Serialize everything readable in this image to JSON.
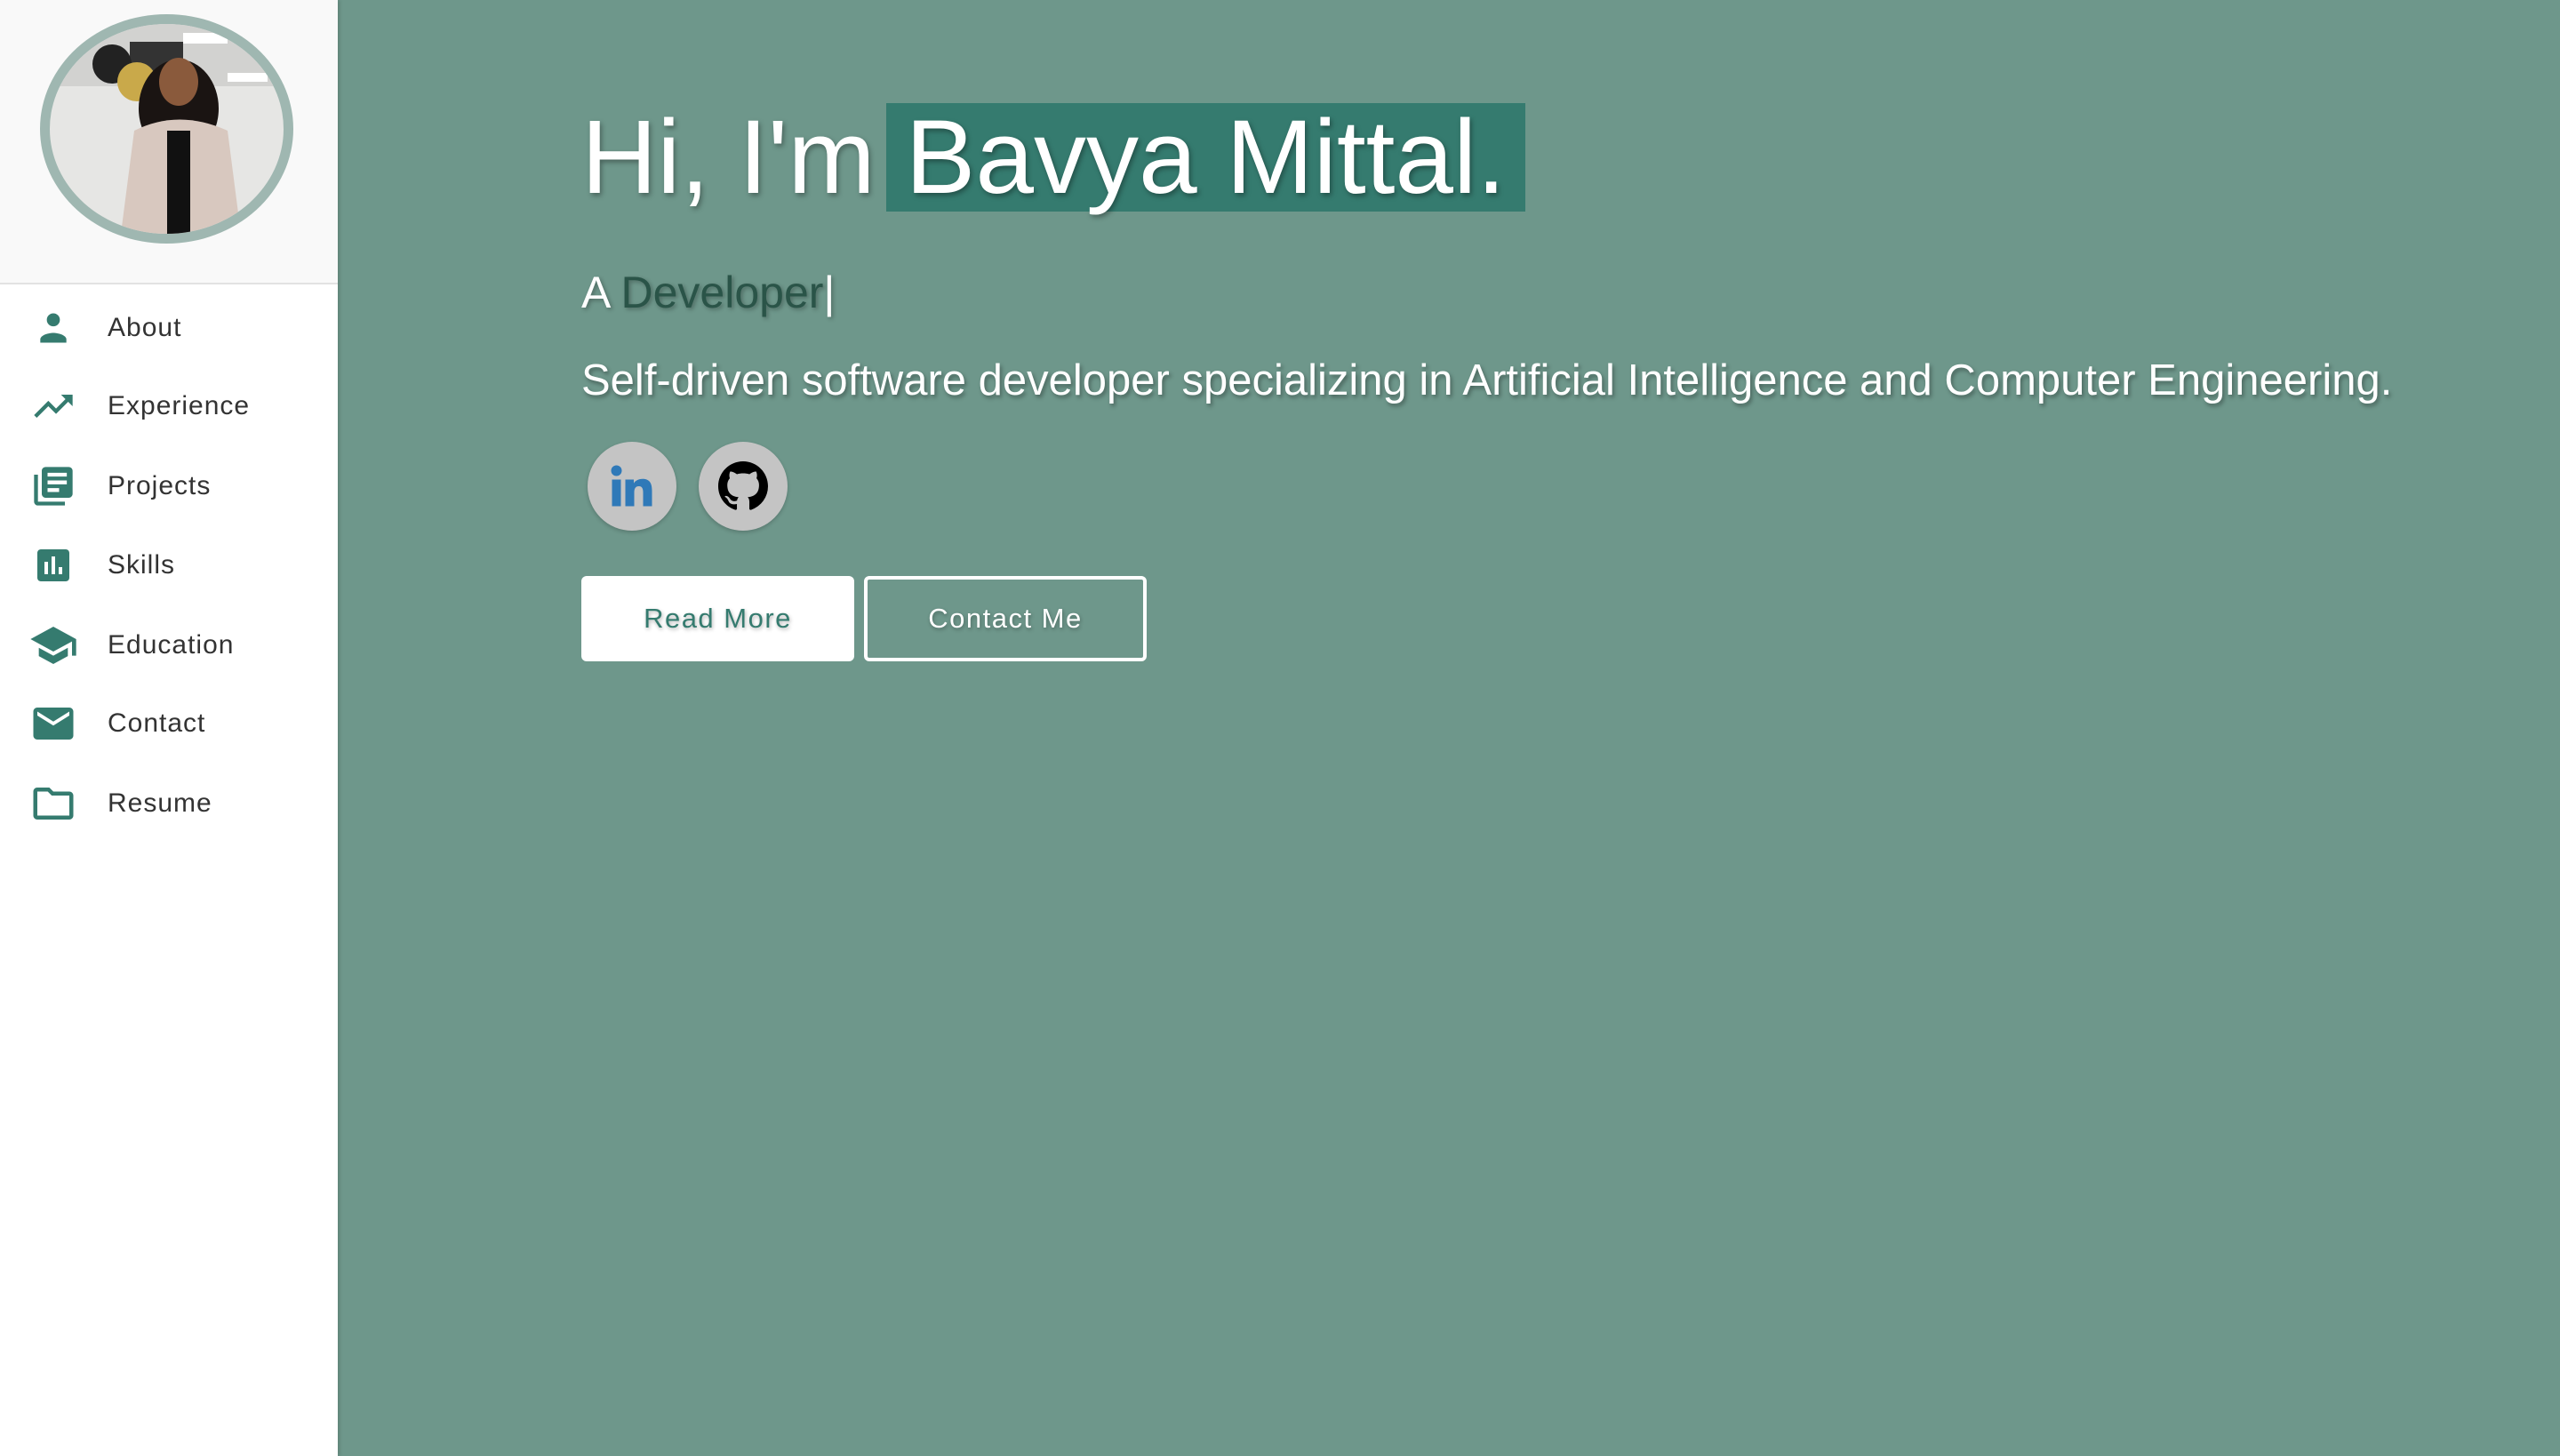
{
  "sidebar": {
    "items": [
      {
        "label": "About",
        "icon": "person-icon"
      },
      {
        "label": "Experience",
        "icon": "trending-up-icon"
      },
      {
        "label": "Projects",
        "icon": "library-books-icon"
      },
      {
        "label": "Skills",
        "icon": "bar-chart-icon"
      },
      {
        "label": "Education",
        "icon": "graduation-cap-icon"
      },
      {
        "label": "Contact",
        "icon": "mail-icon"
      },
      {
        "label": "Resume",
        "icon": "folder-icon"
      }
    ]
  },
  "hero": {
    "greeting": "Hi, I'm",
    "name": "Bavya Mittal.",
    "subtitle_prefix": "A",
    "subtitle_role": "Developer",
    "cursor": "|",
    "description": "Self-driven software developer specializing in Artificial Intelligence and Computer Engineering.",
    "read_more_label": "Read More",
    "contact_label": "Contact Me"
  },
  "colors": {
    "accent": "#357b6f",
    "background": "#6e978b",
    "sidebar": "#ffffff",
    "linkedin": "#2f79b8"
  }
}
